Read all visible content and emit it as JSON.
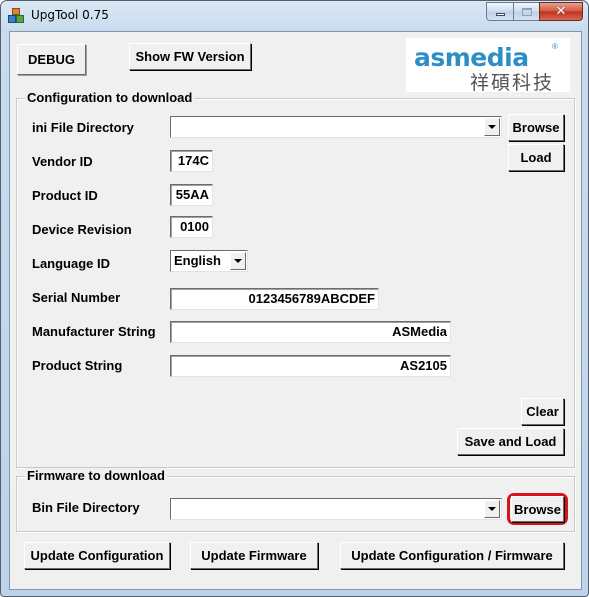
{
  "window": {
    "title": "UpgTool 0.75",
    "icons": {
      "app": "app-icon",
      "minimize": "minimize-icon",
      "maximize": "maximize-icon",
      "close": "close-icon"
    }
  },
  "toolbar": {
    "debug_label": "DEBUG",
    "show_fw_label": "Show FW Version"
  },
  "logo": {
    "brand": "asmedia",
    "registered": "®",
    "chinese": "祥碩科技",
    "brand_color": "#2d8fc4"
  },
  "config": {
    "title": "Configuration to download",
    "ini_label": "ini File Directory",
    "ini_value": "",
    "browse_label": "Browse",
    "load_label": "Load",
    "vendor_label": "Vendor ID",
    "vendor_value": "174C",
    "product_label": "Product ID",
    "product_value": "55AA",
    "revision_label": "Device Revision",
    "revision_value": "0100",
    "language_label": "Language ID",
    "language_value": "English",
    "serial_label": "Serial Number",
    "serial_value": "0123456789ABCDEF",
    "manufacturer_label": "Manufacturer String",
    "manufacturer_value": "ASMedia",
    "product_string_label": "Product String",
    "product_string_value": "AS2105",
    "clear_label": "Clear",
    "save_load_label": "Save and Load"
  },
  "firmware": {
    "title": "Firmware to download",
    "bin_label": "Bin File Directory",
    "bin_value": "",
    "browse_label": "Browse",
    "highlight_color": "#d7141a"
  },
  "actions": {
    "update_config_label": "Update Configuration",
    "update_fw_label": "Update Firmware",
    "update_both_label": "Update Configuration / Firmware"
  }
}
